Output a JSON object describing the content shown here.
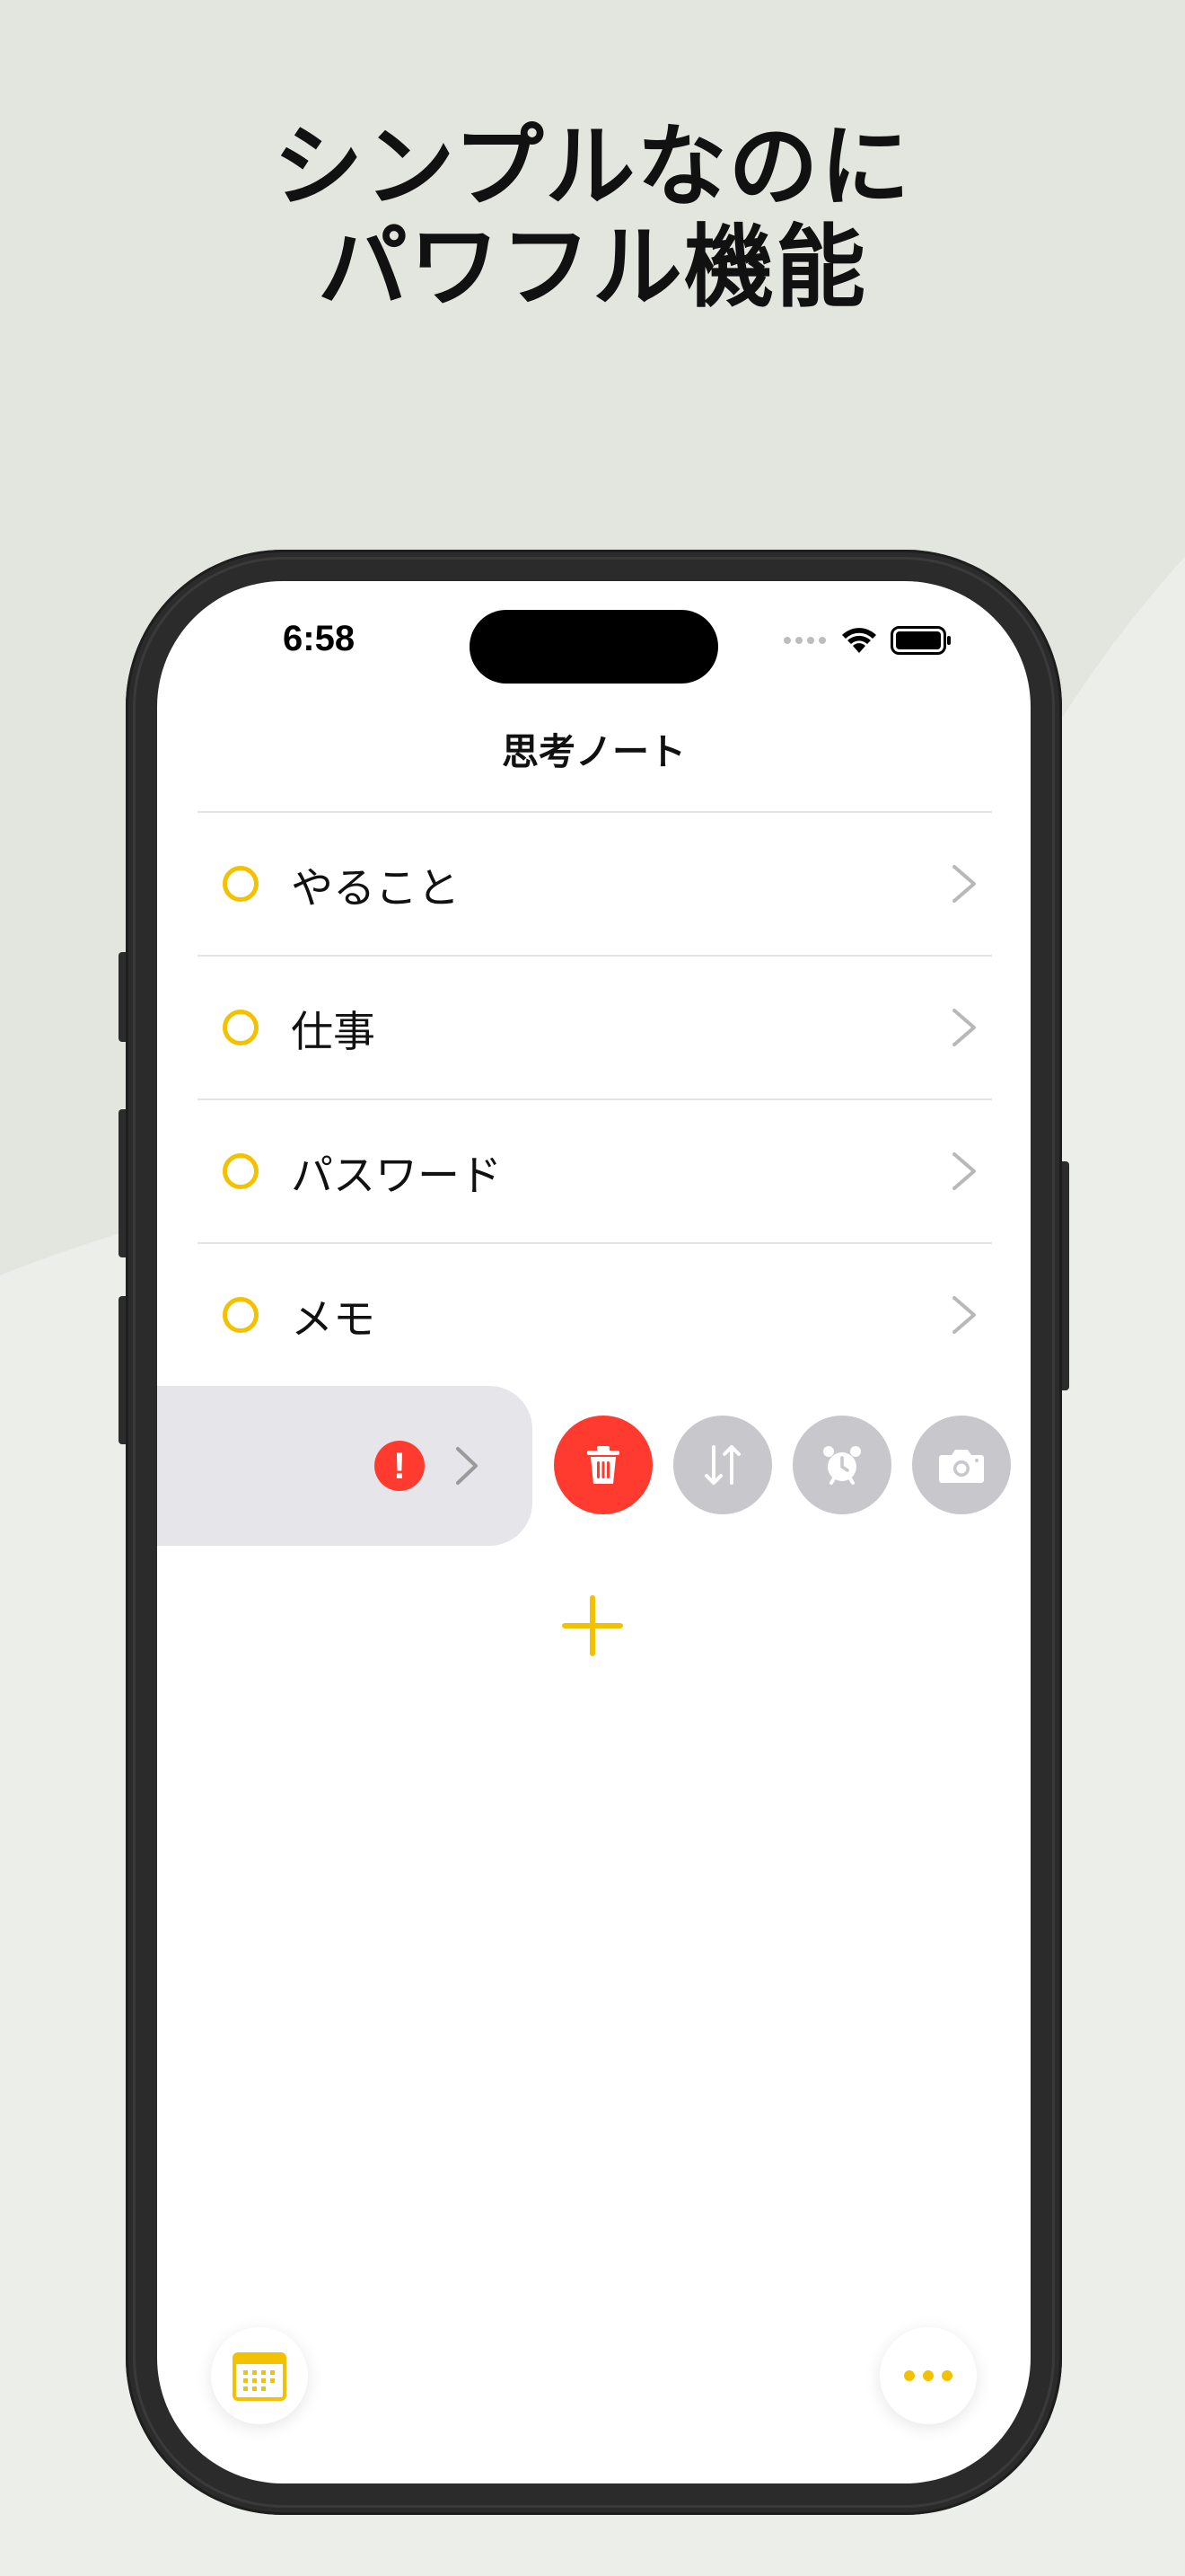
{
  "headline": {
    "line1": "シンプルなのに",
    "line2": "パワフル機能"
  },
  "status_bar": {
    "time": "6:58"
  },
  "nav": {
    "title": "思考ノート"
  },
  "list": {
    "items": [
      {
        "label": "やること"
      },
      {
        "label": "仕事"
      },
      {
        "label": "パスワード"
      },
      {
        "label": "メモ"
      }
    ]
  },
  "swipe_row": {
    "alert_badge": "!",
    "actions": [
      "trash-icon",
      "reorder-icon",
      "alarm-icon",
      "camera-icon"
    ]
  },
  "toolbar": {
    "left_icon": "calendar-icon",
    "right_icon": "more-icon"
  },
  "colors": {
    "accent": "#f2c200",
    "destructive": "#ff3b30",
    "action_gray": "#c7c7cc",
    "swipe_row_bg": "#e5e5ea",
    "page_bg": "#e9ebe6"
  }
}
